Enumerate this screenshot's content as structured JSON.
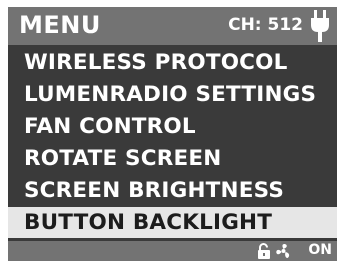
{
  "header": {
    "title": "MENU",
    "channel": "CH: 512",
    "power_icon": "plug-icon"
  },
  "menu": {
    "items": [
      {
        "label": "WIRELESS PROTOCOL"
      },
      {
        "label": "LUMENRADIO SETTINGS"
      },
      {
        "label": "FAN CONTROL"
      },
      {
        "label": "ROTATE SCREEN"
      },
      {
        "label": "SCREEN BRIGHTNESS"
      },
      {
        "label": "BUTTON BACKLIGHT",
        "selected": true
      }
    ]
  },
  "footer": {
    "lock_icon": "unlock-icon",
    "fan_icon": "fan-icon",
    "state": "ON"
  },
  "colors": {
    "header_bg": "#737373",
    "screen_bg": "#3a3a3a",
    "selected_bg": "#e6e6e6",
    "text": "#ffffff"
  }
}
